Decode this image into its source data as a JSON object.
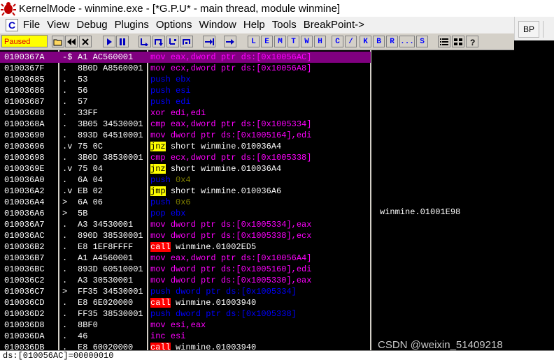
{
  "window": {
    "title": "KernelMode - winmine.exe - [*G.P.U* - main thread, module winmine]",
    "icon": "bug-icon"
  },
  "menu": {
    "logo": "C",
    "items": [
      "File",
      "View",
      "Debug",
      "Plugins",
      "Options",
      "Window",
      "Help",
      "Tools",
      "BreakPoint->"
    ]
  },
  "right_panel": {
    "bp_label": "BP"
  },
  "toolbar": {
    "status": "Paused",
    "letters": [
      "L",
      "E",
      "M",
      "T",
      "W",
      "H",
      "C",
      "/",
      "K",
      "B",
      "R",
      "...",
      "S"
    ]
  },
  "disassembly": [
    {
      "addr": "0100367A",
      "mark": "-$",
      "hex": "A1 AC560001",
      "mnemonic": "mov",
      "args": "eax,dword ptr ds:[0x10056AC]",
      "kind": "mov",
      "selected": true
    },
    {
      "addr": "0100367F",
      "mark": ".",
      "hex": "8B0D A8560001",
      "mnemonic": "mov",
      "args": "ecx,dword ptr ds:[0x10056A8]",
      "kind": "mov"
    },
    {
      "addr": "01003685",
      "mark": ".",
      "hex": "53",
      "mnemonic": "push",
      "args": "ebx",
      "kind": "push"
    },
    {
      "addr": "01003686",
      "mark": ".",
      "hex": "56",
      "mnemonic": "push",
      "args": "esi",
      "kind": "push"
    },
    {
      "addr": "01003687",
      "mark": ".",
      "hex": "57",
      "mnemonic": "push",
      "args": "edi",
      "kind": "push"
    },
    {
      "addr": "01003688",
      "mark": ".",
      "hex": "33FF",
      "mnemonic": "xor",
      "args": "edi,edi",
      "kind": "xor"
    },
    {
      "addr": "0100368A",
      "mark": ".",
      "hex": "3B05 34530001",
      "mnemonic": "cmp",
      "args": "eax,dword ptr ds:[0x1005334]",
      "kind": "cmp"
    },
    {
      "addr": "01003690",
      "mark": ".",
      "hex": "893D 64510001",
      "mnemonic": "mov",
      "args": "dword ptr ds:[0x1005164],edi",
      "kind": "mov"
    },
    {
      "addr": "01003696",
      "mark": ".v",
      "hex": "75 0C",
      "mnemonic": "jnz",
      "args": "short winmine.010036A4",
      "kind": "jnz"
    },
    {
      "addr": "01003698",
      "mark": ".",
      "hex": "3B0D 38530001",
      "mnemonic": "cmp",
      "args": "ecx,dword ptr ds:[0x1005338]",
      "kind": "cmp"
    },
    {
      "addr": "0100369E",
      "mark": ".v",
      "hex": "75 04",
      "mnemonic": "jnz",
      "args": "short winmine.010036A4",
      "kind": "jnz"
    },
    {
      "addr": "010036A0",
      "mark": ".",
      "hex": "6A 04",
      "mnemonic": "push",
      "args": "0x4",
      "kind": "push2"
    },
    {
      "addr": "010036A2",
      "mark": ".v",
      "hex": "EB 02",
      "mnemonic": "jmp",
      "args": "short winmine.010036A6",
      "kind": "jmp"
    },
    {
      "addr": "010036A4",
      "mark": ">",
      "hex": "6A 06",
      "mnemonic": "push",
      "args": "0x6",
      "kind": "push2"
    },
    {
      "addr": "010036A6",
      "mark": ">",
      "hex": "5B",
      "mnemonic": "pop",
      "args": "ebx",
      "kind": "push"
    },
    {
      "addr": "010036A7",
      "mark": ".",
      "hex": "A3 34530001",
      "mnemonic": "mov",
      "args": "dword ptr ds:[0x1005334],eax",
      "kind": "mov"
    },
    {
      "addr": "010036AC",
      "mark": ".",
      "hex": "890D 38530001",
      "mnemonic": "mov",
      "args": "dword ptr ds:[0x1005338],ecx",
      "kind": "mov"
    },
    {
      "addr": "010036B2",
      "mark": ".",
      "hex": "E8 1EF8FFFF",
      "mnemonic": "call",
      "args": "winmine.01002ED5",
      "kind": "call"
    },
    {
      "addr": "010036B7",
      "mark": ".",
      "hex": "A1 A4560001",
      "mnemonic": "mov",
      "args": "eax,dword ptr ds:[0x10056A4]",
      "kind": "mov"
    },
    {
      "addr": "010036BC",
      "mark": ".",
      "hex": "893D 60510001",
      "mnemonic": "mov",
      "args": "dword ptr ds:[0x1005160],edi",
      "kind": "mov"
    },
    {
      "addr": "010036C2",
      "mark": ".",
      "hex": "A3 30530001",
      "mnemonic": "mov",
      "args": "dword ptr ds:[0x1005330],eax",
      "kind": "mov"
    },
    {
      "addr": "010036C7",
      "mark": ">",
      "hex": "FF35 34530001",
      "mnemonic": "push",
      "args": "dword ptr ds:[0x1005334]",
      "kind": "push"
    },
    {
      "addr": "010036CD",
      "mark": ".",
      "hex": "E8 6E020000",
      "mnemonic": "call",
      "args": "winmine.01003940",
      "kind": "call"
    },
    {
      "addr": "010036D2",
      "mark": ".",
      "hex": "FF35 38530001",
      "mnemonic": "push",
      "args": "dword ptr ds:[0x1005338]",
      "kind": "push"
    },
    {
      "addr": "010036D8",
      "mark": ".",
      "hex": "8BF0",
      "mnemonic": "mov",
      "args": "esi,eax",
      "kind": "mov"
    },
    {
      "addr": "010036DA",
      "mark": ".",
      "hex": "46",
      "mnemonic": "inc",
      "args": "esi",
      "kind": "inc"
    },
    {
      "addr": "010036DB",
      "mark": ".",
      "hex": "E8 60020000",
      "mnemonic": "call",
      "args": "winmine.01003940",
      "kind": "call"
    }
  ],
  "comment": "winmine.01001E98",
  "statusbar": "ds:[010056AC]=00000010",
  "watermark": "CSDN @weixin_51409218"
}
